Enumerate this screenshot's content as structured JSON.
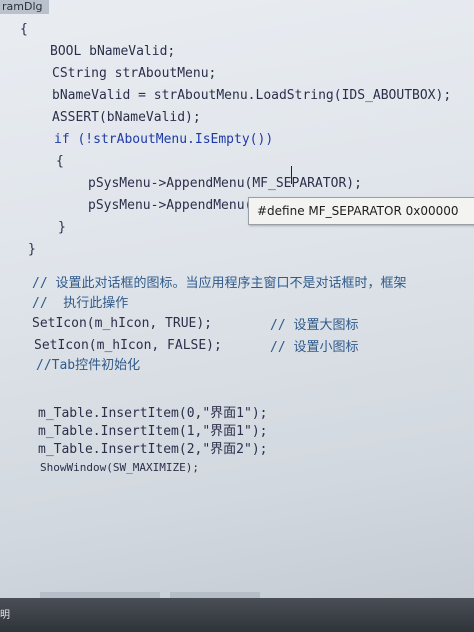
{
  "editor": {
    "tab_title": "ramDlg",
    "lines": [
      "{",
      "BOOL bNameValid;",
      "CString strAboutMenu;",
      "bNameValid = strAboutMenu.LoadString(IDS_ABOUTBOX);",
      "ASSERT(bNameValid);",
      "if (!strAboutMenu.IsEmpty())",
      "{",
      "pSysMenu->AppendMenu(MF_SEPARATOR);",
      "pSysMenu->AppendMenu(",
      "}",
      "}",
      "// 设置此对话框的图标。当应用程序主窗口不是对话框时，框架",
      "//  执行此操作",
      "SetIcon(m_hIcon, TRUE);",
      "// 设置大图标",
      "SetIcon(m_hIcon, FALSE);",
      "// 设置小图标",
      "//Tab控件初始化",
      "m_Table.InsertItem(0,\"界面1\");",
      "m_Table.InsertItem(1,\"界面1\");",
      "m_Table.InsertItem(2,\"界面2\");",
      "ShowWindow(SW_MAXIMIZE);"
    ],
    "tooltip": "#define MF_SEPARATOR 0x00000"
  },
  "status_bar": {
    "left_text": "明"
  },
  "colors": {
    "keyword": "#1f3aa8",
    "comment": "#2f5a8a",
    "string": "#9a3b2a",
    "text": "#2c2f4a"
  }
}
